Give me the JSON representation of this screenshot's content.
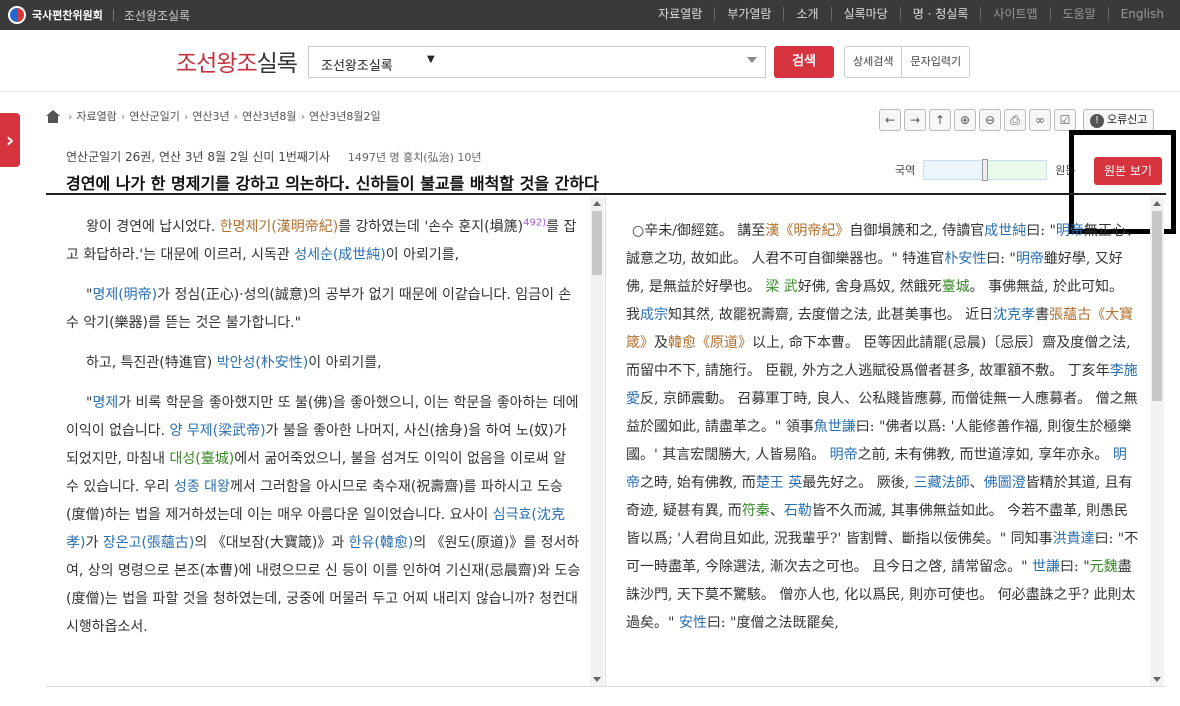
{
  "topbar": {
    "org": "국사편찬위원회",
    "site": "조선왕조실록",
    "menu": [
      "자료열람",
      "부가열람",
      "소개",
      "실록마당",
      "명 · 청실록",
      "사이트맵",
      "도움말",
      "English"
    ]
  },
  "header": {
    "brand_red": "조선왕조",
    "brand_dark": "실록",
    "search_select": "조선왕조실록",
    "search_button": "검색",
    "adv_search": "상세검색",
    "char_input": "문자입력기"
  },
  "breadcrumb": [
    "자료열람",
    "연산군일기",
    "연산3년",
    "연산3년8월",
    "연산3년8월2일"
  ],
  "toolbar": {
    "report": "오류신고"
  },
  "article": {
    "meta": "연산군일기 26권, 연산 3년 8월 2일 신미 1번째기사",
    "year": "1497년 명 홍치(弘治) 10년",
    "title": "경연에 나가 한 명제기를 강하고 의논하다. 신하들이 불교를 배척할 것을 간하다"
  },
  "view": {
    "korean_label": "국역",
    "original_label": "원문",
    "original_button": "원본 보기"
  },
  "korean": {
    "p1_a": "왕이 경연에 납시었다. ",
    "p1_b": "한명제기(漢明帝紀)",
    "p1_c": "를 강하였는데 '손수 훈지(塤篪)",
    "p1_sup": "492)",
    "p1_d": "를 잡고 화답하라.'는 대문에 이르러, 시독관 ",
    "p1_e": "성세순(成世純)",
    "p1_f": "이 아뢰기를,",
    "p2_a": "\"",
    "p2_b": "명제(明帝)",
    "p2_c": "가 정심(正心)·성의(誠意)의 공부가 없기 때문에 이같습니다. 임금이 손수 악기(樂器)를 뜯는 것은 불가합니다.\"",
    "p3_a": "하고, 특진관(特進官) ",
    "p3_b": "박안성(朴安性)",
    "p3_c": "이 아뢰기를,",
    "p4_a": "\"",
    "p4_b": "명제",
    "p4_c": "가 비록 학문을 좋아했지만 또 불(佛)을 좋아했으니, 이는 학문을 좋아하는 데에 이익이 없습니다. ",
    "p4_d": "양 무제(梁武帝)",
    "p4_e": "가 불을 좋아한 나머지, 사신(捨身)을 하여 노(奴)가 되었지만, 마침내 ",
    "p4_f": "대성(臺城)",
    "p4_g": "에서 굶어죽었으니, 불을 섬겨도 이익이 없음을 이로써 알 수 있습니다. 우리 ",
    "p4_h": "성종 대왕",
    "p4_i": "께서 그러함을 아시므로 축수재(祝壽齋)를 파하시고 도승(度僧)하는 법을 제거하셨는데 이는 매우 아름다운 일이었습니다. 요사이 ",
    "p4_j": "심극효(沈克孝)",
    "p4_k": "가 ",
    "p4_l": "장온고(張蘊古)",
    "p4_m": "의 《대보잠(大寶箴)》과 ",
    "p4_n": "한유(韓愈)",
    "p4_o": "의 《원도(原道)》를 정서하여, 상의 명령으로 본조(本曹)에 내렸으므로 신 등이 이를 인하여 기신재(忌晨齋)와 도승(度僧)는 법을 파할 것을 청하였는데, 궁중에 머물러 두고 어찌 내리지 않습니까? 청컨대 시행하옵소서."
  },
  "hanmun": {
    "s01": "○辛未/御經筵。 講至",
    "s02": "漢《明帝紀》",
    "s03": "自御塤篪和之, 侍讀官",
    "s04": "成世純",
    "s05": "曰: \"",
    "s06": "明帝",
    "s07": "無正心、誠意之功, 故如此。 人君不可自御樂器也。\" 特進官",
    "s08": "朴安性",
    "s09": "曰: \"",
    "s10": "明帝",
    "s11": "雖好學, 又好佛, 是無益於好學也。 ",
    "s12": "梁 武",
    "s13": "好佛, 舍身爲奴, 然餓死",
    "s14": "臺城",
    "s15": "。 事佛無益, 於此可知。 我",
    "s16": "成宗",
    "s17": "知其然, 故罷祝壽齋, 去度僧之法, 此甚美事也。 近日",
    "s18": "沈克孝",
    "s19": "書",
    "s20": "張蘊古《大寶箴》",
    "s21": "及",
    "s22": "韓愈《原道》",
    "s23": "以上, 命下本曹。 臣等因此請罷(忌晨)",
    "s24": "〔忌辰〕齋及度僧之法, 而留中不下, 請施行。 臣觀, 外方之人逃賦役爲僧者甚多, 故軍額不敷。 丁亥年",
    "s25": "李施愛",
    "s26": "反, 京師震動。 召募軍丁時, 良人、公私賤皆應募, 而僧徒無一人應募者。 僧之無益於國如此, 請盡革之。\" 領事",
    "s27": "魚世謙",
    "s28": "曰: \"佛者以爲: '人能修善作福, 則復生於極樂國。' 其言宏闊勝大, 人皆易陷。 ",
    "s29": "明帝",
    "s30": "之前, 未有佛教, 而世道淳如, 享年亦永。 ",
    "s31": "明帝",
    "s32": "之時, 始有佛教, 而",
    "s33": "楚王 英",
    "s34": "最先好之。 厥後, ",
    "s35": "三藏法師",
    "s36": "、",
    "s37": "佛圖澄",
    "s38": "皆精於其道, 且有奇迹, 疑甚有異, 而",
    "s39": "符秦",
    "s40": "、",
    "s41": "石勒",
    "s42": "皆不久而滅, 其事佛無益如此。 今若不盡革, 則愚民皆以爲; '人君尙且如此, 況我輩乎?' 皆割臂、斷指以佞佛矣。\" 同知事",
    "s43": "洪貴達",
    "s44": "曰: \"不可一時盡革, 今除選法, 漸次去之可也。 且今日之啓, 請常留念。\" ",
    "s45": "世謙",
    "s46": "曰: \"",
    "s47": "元魏",
    "s48": "盡誅沙門, 天下莫不驚駭。 僧亦人也, 化以爲民, 則亦可使也。 何必盡誅之乎? 此則太過矣。\" ",
    "s49": "安性",
    "s50": "曰: \"度僧之法既罷矣,"
  }
}
